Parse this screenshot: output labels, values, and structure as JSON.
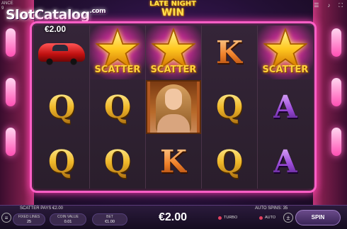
{
  "hud": {
    "line1": "ANCE",
    "line2": "9"
  },
  "watermark": {
    "main": "SlotCatalog",
    "tld": ".com"
  },
  "game_title": {
    "line1": "LATE NIGHT",
    "line2": "WIN"
  },
  "top_icons": [
    "menu-icon",
    "sound-icon",
    "fullscreen-icon"
  ],
  "win_amount": "€2.00",
  "scatter_label": "SCATTER",
  "reels": [
    [
      "car",
      "Q",
      "Q"
    ],
    [
      "SCATTER",
      "Q",
      "Q"
    ],
    [
      "SCATTER",
      "lady",
      "K"
    ],
    [
      "K",
      "Q",
      "Q"
    ],
    [
      "SCATTER",
      "A",
      "A"
    ]
  ],
  "footer": {
    "message": "SCATTER PAYS €2.00",
    "autospins": "AUTO SPINS: 35",
    "fixed_lines_label": "FIXED LINES",
    "fixed_lines_value": "25",
    "coin_value_label": "COIN VALUE",
    "coin_value_value": "0.01",
    "bet_label": "BET",
    "bet_value": "€1.00",
    "total_bet": "€2.00",
    "turbo_label": "TURBO",
    "auto_label": "AUTO",
    "spin_label": "SPIN"
  },
  "colors": {
    "frame": "#ff5fc6",
    "gold": "#f2c230",
    "orange": "#f0812a",
    "purple": "#9a4ad8"
  }
}
